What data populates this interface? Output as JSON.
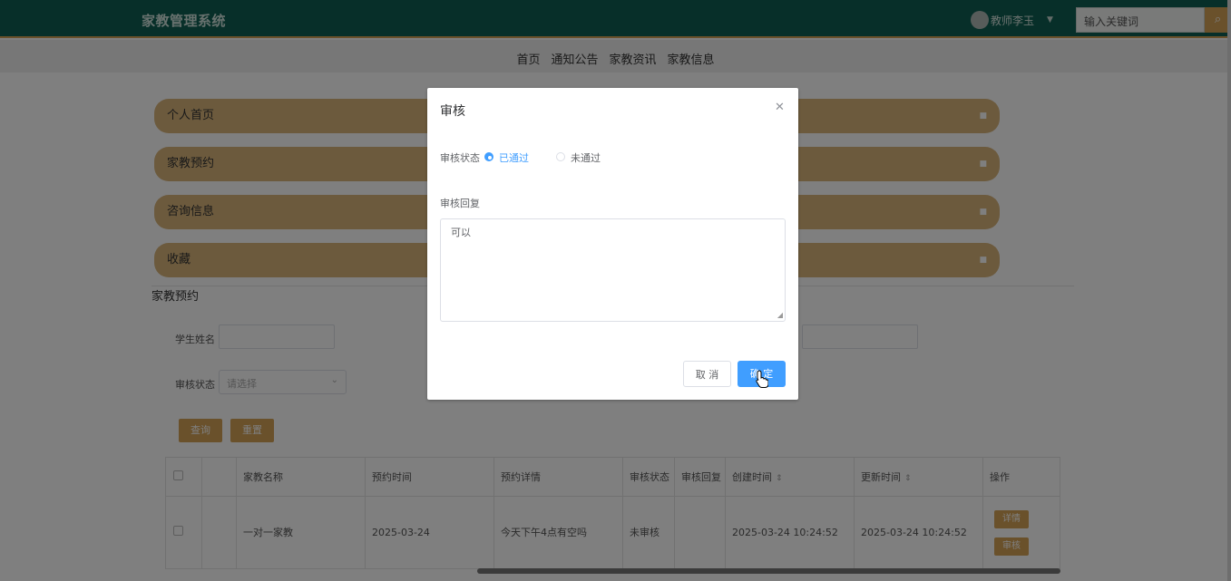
{
  "header": {
    "brand": "家教管理系统",
    "user_name": "教师李玉",
    "search_placeholder": "输入关键词",
    "accent_color": "#d4a257",
    "header_color": "#0f5f52"
  },
  "nav": {
    "items": [
      {
        "label": "首页"
      },
      {
        "label": "通知公告"
      },
      {
        "label": "家教资讯"
      },
      {
        "label": "家教信息"
      }
    ]
  },
  "side_menu": {
    "items": [
      {
        "label": "个人首页"
      },
      {
        "label": "家教预约"
      },
      {
        "label": "咨询信息"
      },
      {
        "label": "收藏"
      }
    ]
  },
  "main": {
    "section_title": "家教预约",
    "filters": {
      "student_name_label": "学生姓名",
      "audit_status_label": "审核状态",
      "audit_status_placeholder": "请选择",
      "query_button": "查询",
      "reset_button": "重置"
    },
    "table": {
      "headers": [
        "家教名称",
        "预约时间",
        "预约详情",
        "审核状态",
        "审核回复",
        "创建时间",
        "更新时间",
        "操作"
      ],
      "rows": [
        {
          "name": "一对一家教",
          "appointment_time": "2025-03-24",
          "details": "今天下午4点有空吗",
          "audit_status": "未审核",
          "audit_reply": "",
          "created_at": "2025-03-24 10:24:52",
          "updated_at": "2025-03-24 10:24:52",
          "detail_button": "详情",
          "audit_button": "审核"
        }
      ]
    }
  },
  "dialog": {
    "title": "审核",
    "status_label": "审核状态",
    "option_passed": "已通过",
    "option_failed": "未通过",
    "selected": "已通过",
    "reply_label": "审核回复",
    "reply_value": "可以",
    "cancel_button": "取 消",
    "confirm_button": "确 定",
    "primary_color": "#409eff"
  }
}
